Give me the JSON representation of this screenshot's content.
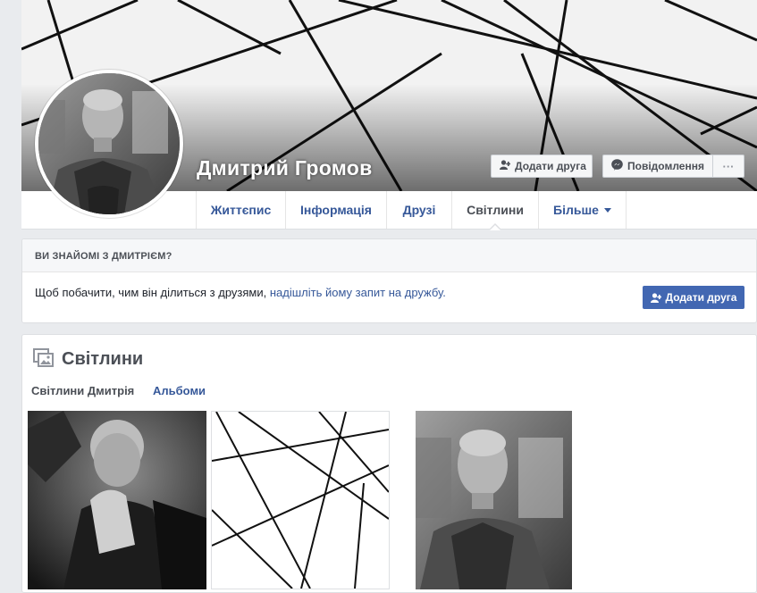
{
  "profile": {
    "name": "Дмитрий Громов"
  },
  "cover_actions": {
    "add_friend_label": "Додати друга",
    "message_label": "Повідомлення",
    "more_label": "···"
  },
  "nav": {
    "tabs": [
      {
        "label": "Життєпис"
      },
      {
        "label": "Інформація"
      },
      {
        "label": "Друзі"
      },
      {
        "label": "Світлини"
      },
      {
        "label": "Більше"
      }
    ],
    "active": "Світлини"
  },
  "know_card": {
    "title": "ВИ ЗНАЙОМІ З ДМИТРІЄМ?",
    "text": "Щоб побачити, чим він ділиться з друзями, ",
    "link_text": "надішліть йому запит на дружбу.",
    "button_label": "Додати друга"
  },
  "photos": {
    "title": "Світлини",
    "tabs": [
      {
        "label": "Світлини Дмитрія"
      },
      {
        "label": "Альбоми"
      }
    ]
  },
  "colors": {
    "link_blue": "#365899",
    "button_blue": "#4267b2",
    "page_bg": "#e9ebee",
    "text_dark": "#4b4f56"
  }
}
